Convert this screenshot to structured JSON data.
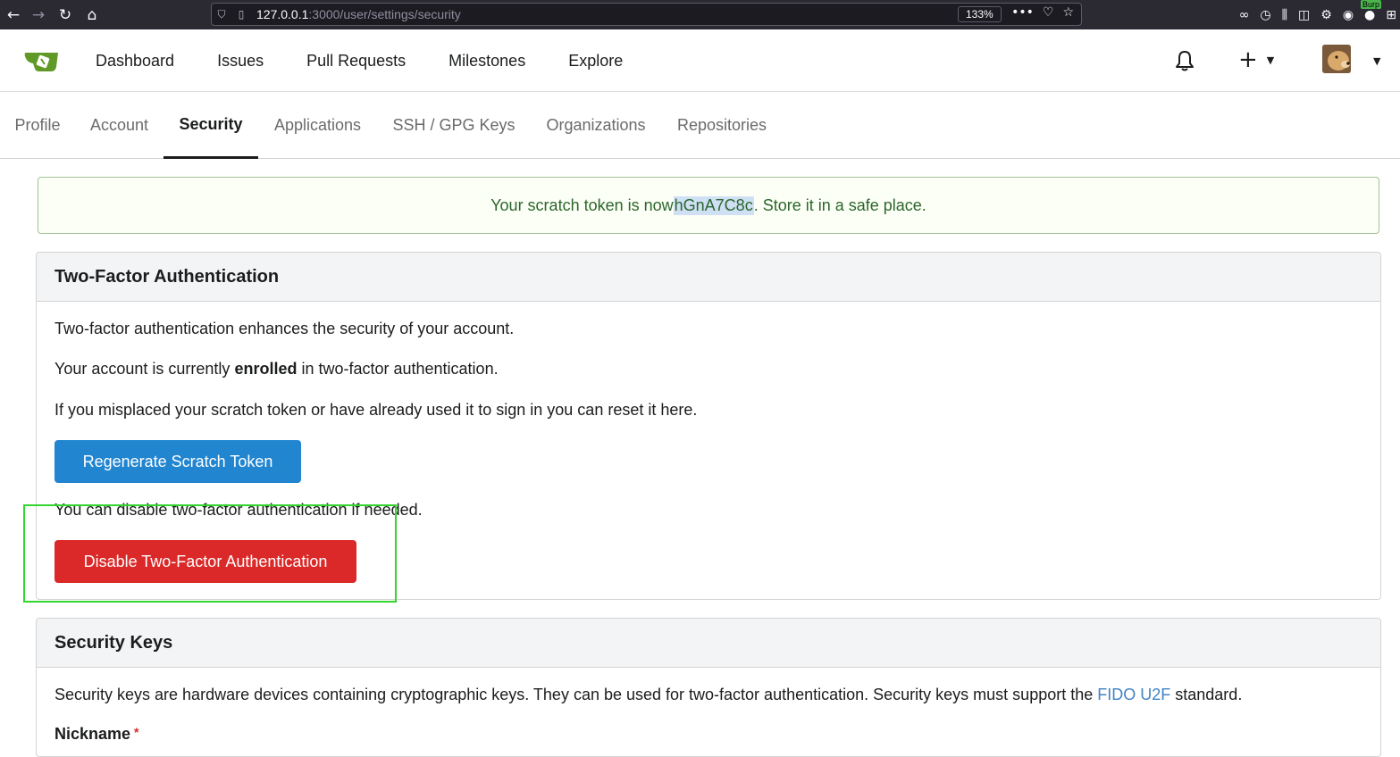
{
  "browser": {
    "url_host": "127.0.0.1",
    "url_path": ":3000/user/settings/security",
    "zoom": "133%",
    "burp_label": "Burp"
  },
  "header": {
    "nav": [
      "Dashboard",
      "Issues",
      "Pull Requests",
      "Milestones",
      "Explore"
    ],
    "plus_icon": "plus-icon",
    "bell_icon": "bell-icon"
  },
  "tabs": [
    {
      "label": "Profile",
      "active": false
    },
    {
      "label": "Account",
      "active": false
    },
    {
      "label": "Security",
      "active": true
    },
    {
      "label": "Applications",
      "active": false
    },
    {
      "label": "SSH / GPG Keys",
      "active": false
    },
    {
      "label": "Organizations",
      "active": false
    },
    {
      "label": "Repositories",
      "active": false
    }
  ],
  "flash": {
    "before": "Your scratch token is now ",
    "token": "hGnA7C8c",
    "after": ". Store it in a safe place."
  },
  "two_factor": {
    "title": "Two-Factor Authentication",
    "p1": "Two-factor authentication enhances the security of your account.",
    "p2_before": "Your account is currently ",
    "p2_bold": "enrolled",
    "p2_after": " in two-factor authentication.",
    "p3": "If you misplaced your scratch token or have already used it to sign in you can reset it here.",
    "regenerate_button": "Regenerate Scratch Token",
    "p4": "You can disable two-factor authentication if needed.",
    "disable_button": "Disable Two-Factor Authentication"
  },
  "security_keys": {
    "title": "Security Keys",
    "desc_before": "Security keys are hardware devices containing cryptographic keys. They can be used for two-factor authentication. Security keys must support the ",
    "desc_link": "FIDO U2F",
    "desc_after": " standard.",
    "nickname_label": "Nickname",
    "required_mark": "*"
  },
  "colors": {
    "primary": "#2185d0",
    "danger": "#db2828",
    "success_text": "#2c662d",
    "highlight_box": "#33d62e"
  }
}
